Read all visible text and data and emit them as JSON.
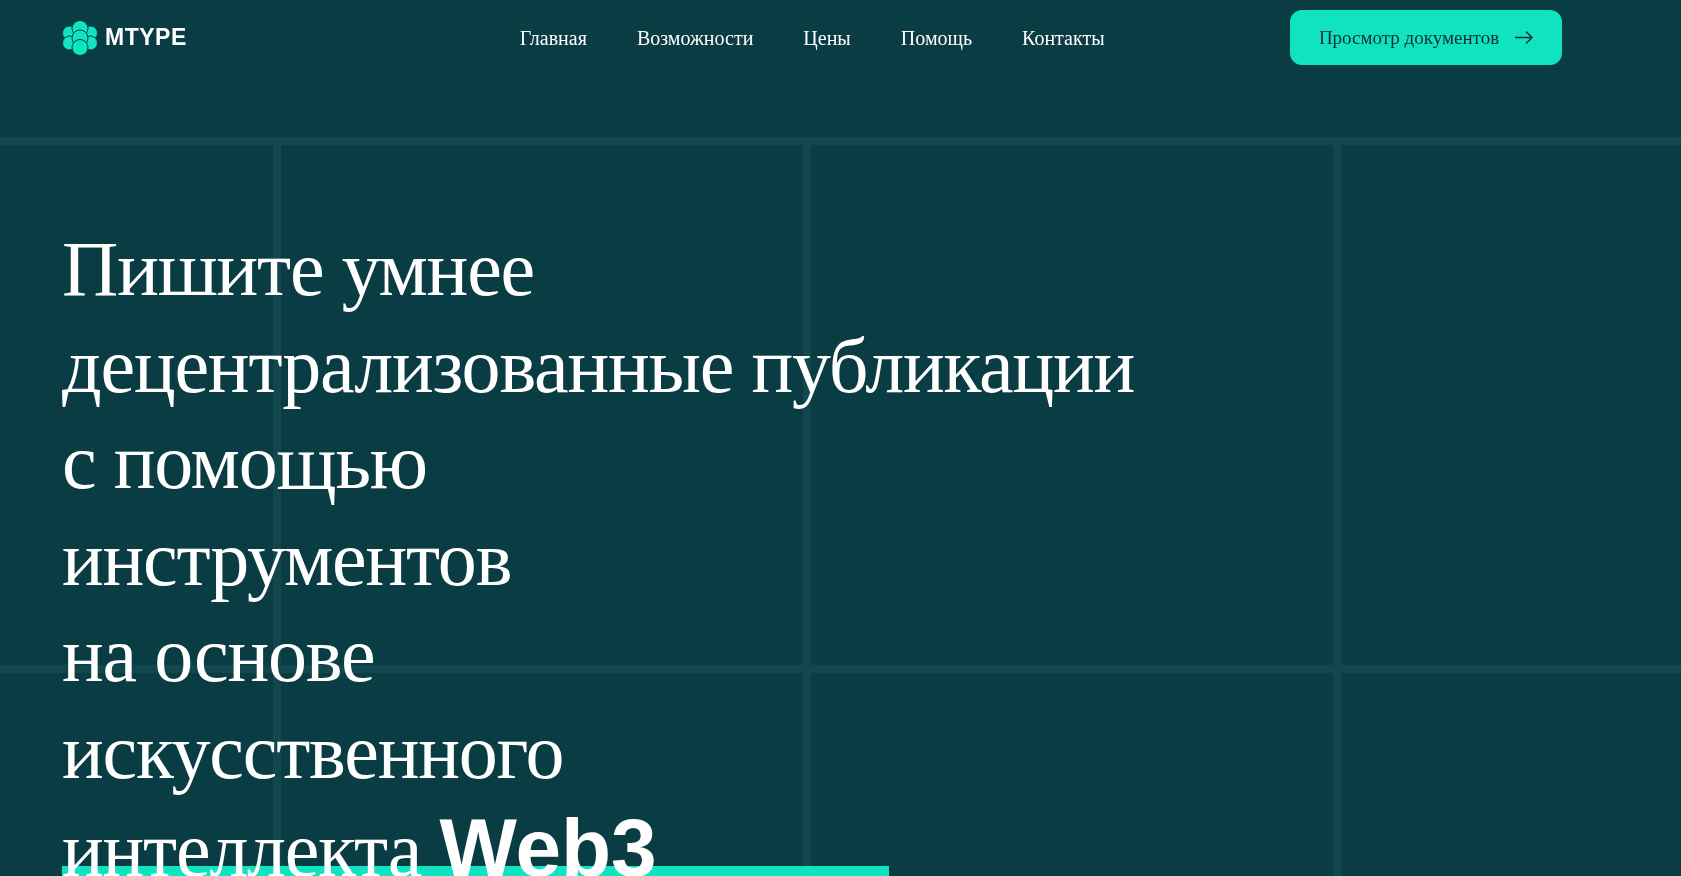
{
  "header": {
    "logo": {
      "text": "MTYPE"
    },
    "nav": [
      {
        "label": "Главная"
      },
      {
        "label": "Возможности"
      },
      {
        "label": "Цены"
      },
      {
        "label": "Помощь"
      },
      {
        "label": "Контакты"
      }
    ],
    "cta_button": {
      "label": "Просмотр документов"
    }
  },
  "hero": {
    "heading": "Пишите умнее\nдецентрализованные публикации\nс помощью\nинструментов\nна основе\nискусственного\nинтеллекта **Web3**"
  }
}
